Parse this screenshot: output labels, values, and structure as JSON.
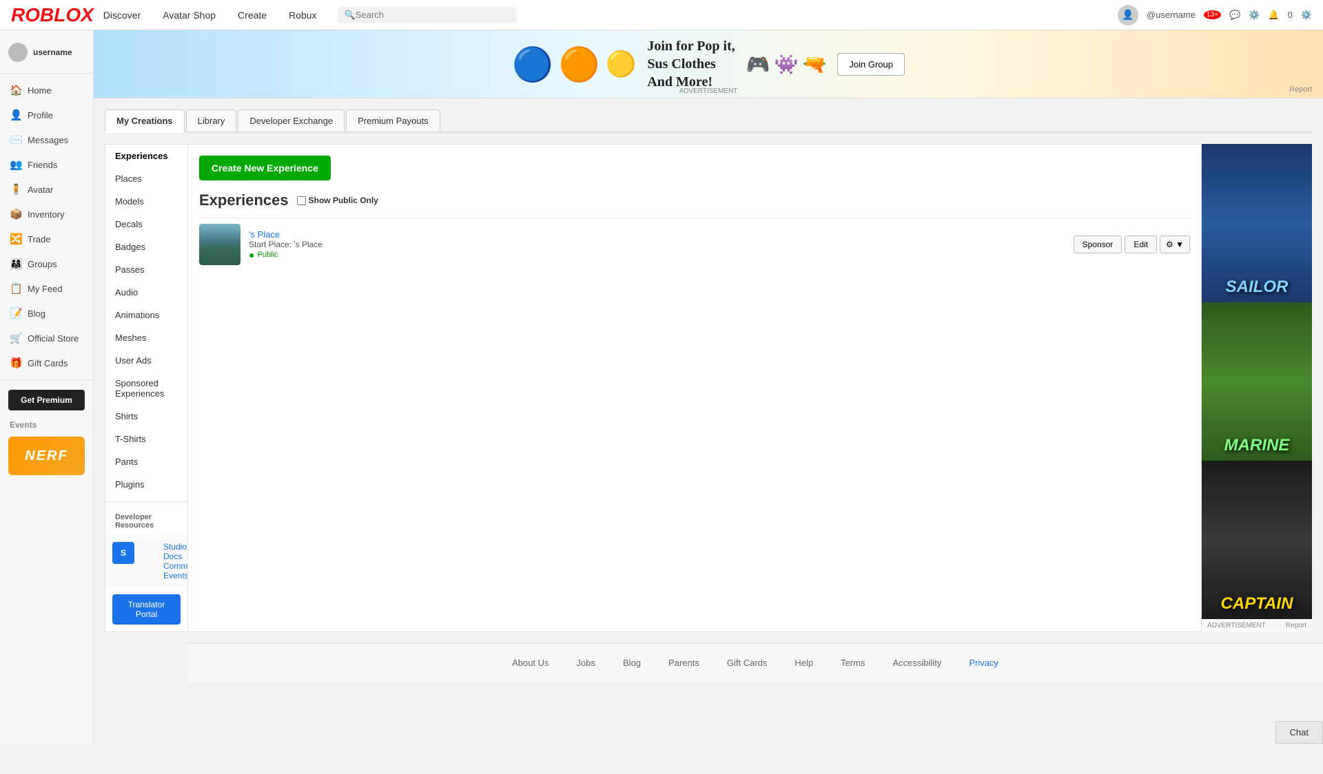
{
  "nav": {
    "logo": "ROBLOX",
    "links": [
      "Discover",
      "Avatar Shop",
      "Create",
      "Robux"
    ],
    "search_placeholder": "Search",
    "username": "@username",
    "age_badge": "13+",
    "notifications": "0"
  },
  "sidebar": {
    "username": "username",
    "items": [
      {
        "label": "Home",
        "icon": "🏠"
      },
      {
        "label": "Profile",
        "icon": "👤"
      },
      {
        "label": "Messages",
        "icon": "✉️"
      },
      {
        "label": "Friends",
        "icon": "👥"
      },
      {
        "label": "Avatar",
        "icon": "🧍"
      },
      {
        "label": "Inventory",
        "icon": "📦"
      },
      {
        "label": "Trade",
        "icon": "🔀"
      },
      {
        "label": "Groups",
        "icon": "👨‍👩‍👧"
      },
      {
        "label": "My Feed",
        "icon": "📋"
      },
      {
        "label": "Blog",
        "icon": "📝"
      },
      {
        "label": "Official Store",
        "icon": "🛒"
      },
      {
        "label": "Gift Cards",
        "icon": "🎁"
      }
    ],
    "get_premium_label": "Get Premium",
    "events_label": "Events",
    "nerf_label": "NERF"
  },
  "ad_banner": {
    "text_line1": "Join for Pop it,",
    "text_line2": "Sus Clothes",
    "text_line3": "And More!",
    "join_btn": "Join Group",
    "advertisement_label": "ADVERTISEMENT",
    "report_label": "Report"
  },
  "tabs": [
    {
      "label": "My Creations",
      "active": true
    },
    {
      "label": "Library",
      "active": false
    },
    {
      "label": "Developer Exchange",
      "active": false
    },
    {
      "label": "Premium Payouts",
      "active": false
    }
  ],
  "left_panel": {
    "items": [
      {
        "label": "Experiences",
        "active": true
      },
      {
        "label": "Places",
        "active": false
      },
      {
        "label": "Models",
        "active": false
      },
      {
        "label": "Decals",
        "active": false
      },
      {
        "label": "Badges",
        "active": false
      },
      {
        "label": "Passes",
        "active": false
      },
      {
        "label": "Audio",
        "active": false
      },
      {
        "label": "Animations",
        "active": false
      },
      {
        "label": "Meshes",
        "active": false
      },
      {
        "label": "User Ads",
        "active": false
      },
      {
        "label": "Sponsored Experiences",
        "active": false
      },
      {
        "label": "Shirts",
        "active": false
      },
      {
        "label": "T-Shirts",
        "active": false
      },
      {
        "label": "Pants",
        "active": false
      },
      {
        "label": "Plugins",
        "active": false
      }
    ],
    "dev_resources_label": "Developer Resources",
    "dev_links": [
      "Studio",
      "Docs",
      "Community",
      "Events"
    ],
    "translator_portal": "Translator Portal"
  },
  "experiences": {
    "title": "Experiences",
    "create_btn": "Create New Experience",
    "show_public_label": "Show Public Only",
    "items": [
      {
        "name": "'s Place",
        "start_place": "'s Place",
        "visibility": "Public",
        "sponsor_btn": "Sponsor",
        "edit_btn": "Edit"
      }
    ]
  },
  "right_ad": {
    "labels": [
      "SAILOR",
      "MARINE",
      "CAPTAIN"
    ],
    "advertisement": "ADVERTISEMENT",
    "report": "Report"
  },
  "footer": {
    "links": [
      "About Us",
      "Jobs",
      "Blog",
      "Parents",
      "Gift Cards",
      "Help",
      "Terms",
      "Accessibility",
      "Privacy"
    ],
    "active_link": "Privacy"
  },
  "chat": {
    "label": "Chat"
  }
}
